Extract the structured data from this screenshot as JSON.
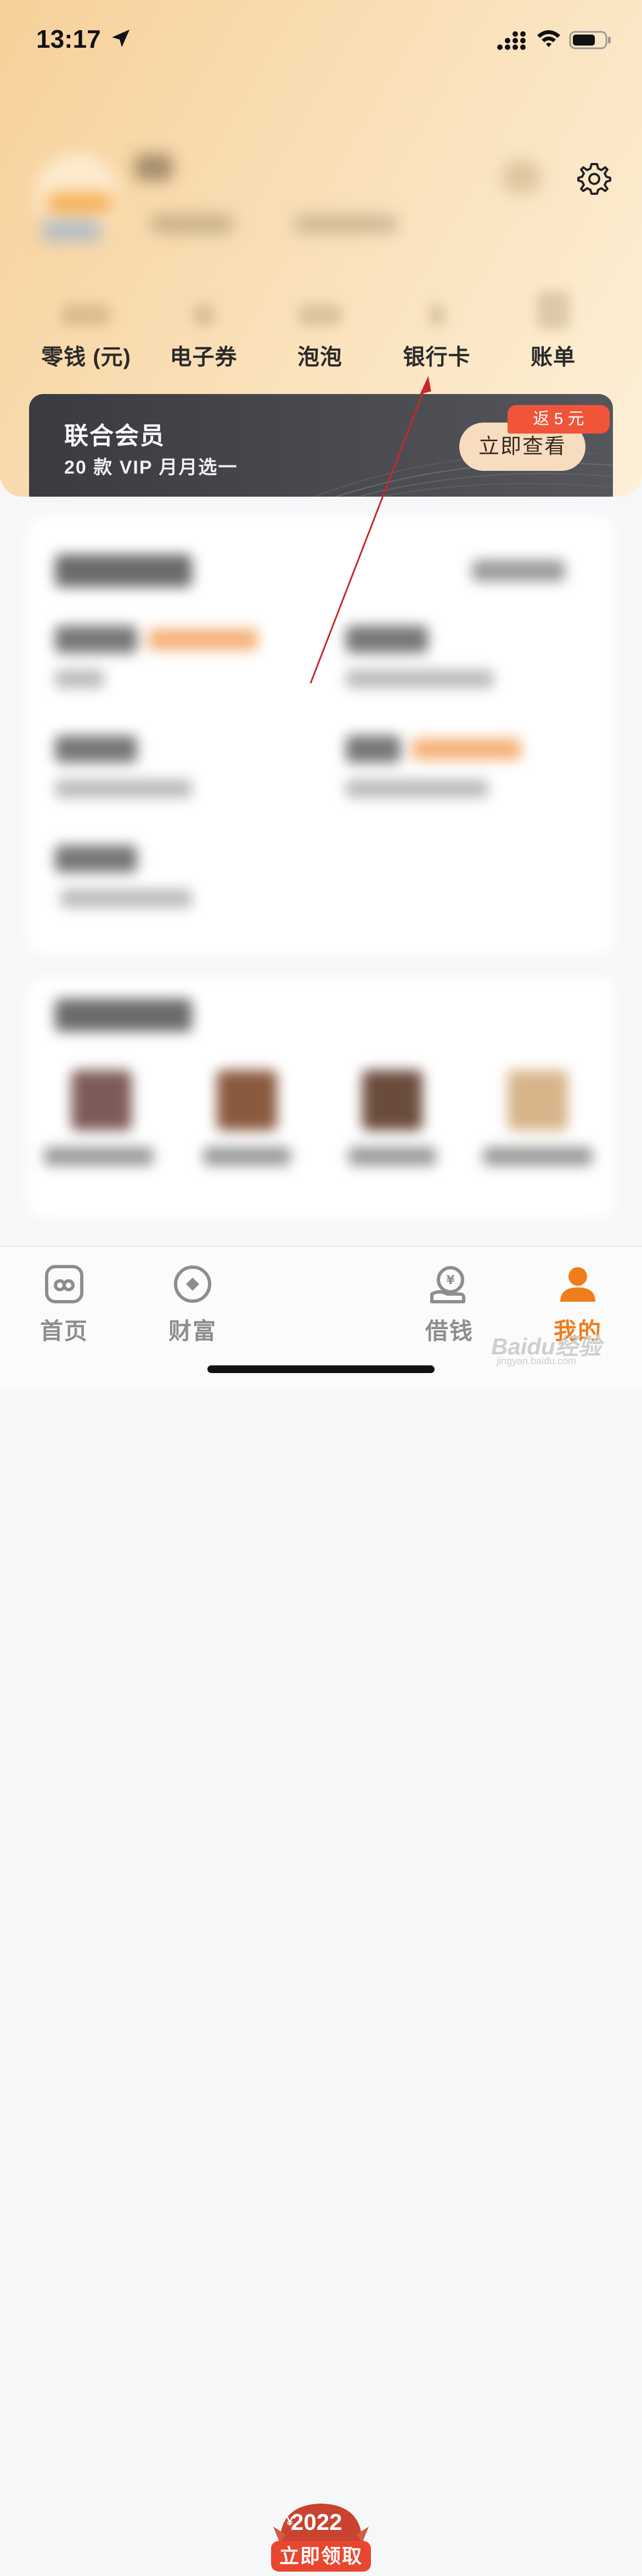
{
  "status": {
    "time": "13:17"
  },
  "stats": [
    {
      "label": "零钱 (元)"
    },
    {
      "label": "电子券"
    },
    {
      "label": "泡泡"
    },
    {
      "label": "银行卡"
    },
    {
      "label": "账单"
    }
  ],
  "vip": {
    "title": "联合会员",
    "subtitle": "20 款 VIP 月月选一",
    "badge": "返 5 元",
    "button": "立即查看"
  },
  "promo": {
    "year": "2022",
    "yen": "¥",
    "button": "立即领取"
  },
  "tabs": [
    {
      "label": "首页"
    },
    {
      "label": "财富"
    },
    {
      "label": "借钱"
    },
    {
      "label": "我的"
    }
  ],
  "watermark": {
    "brand": "Baidu经验",
    "url": "jingyan.baidu.com"
  },
  "colors": {
    "accent": "#ef7d1c",
    "vip_bg": "#3a3b40",
    "badge": "#f0553a",
    "arrow": "#c8262a"
  }
}
